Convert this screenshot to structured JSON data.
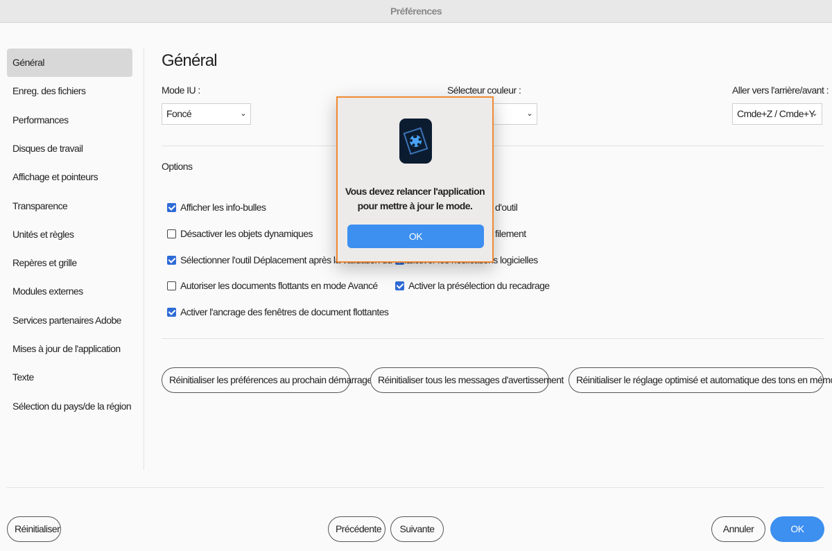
{
  "window": {
    "title": "Préférences"
  },
  "sidebar": {
    "items": [
      {
        "label": "Général",
        "selected": true
      },
      {
        "label": "Enreg. des fichiers"
      },
      {
        "label": "Performances"
      },
      {
        "label": "Disques de travail"
      },
      {
        "label": "Affichage et pointeurs"
      },
      {
        "label": "Transparence"
      },
      {
        "label": "Unités et règles"
      },
      {
        "label": "Repères et grille"
      },
      {
        "label": "Modules externes"
      },
      {
        "label": "Services partenaires Adobe"
      },
      {
        "label": "Mises à jour de l'application"
      },
      {
        "label": "Texte"
      },
      {
        "label": "Sélection du pays/de la région"
      }
    ]
  },
  "main": {
    "title": "Général",
    "ui_mode": {
      "label": "Mode IU :",
      "value": "Foncé"
    },
    "color_picker": {
      "label": "Sélecteur couleur :"
    },
    "undo_redo": {
      "label": "Aller vers l'arrière/avant :",
      "value": "Cmde+Z / Cmde+Y"
    },
    "options_label": "Options",
    "options": [
      {
        "label": "Afficher les info-bulles",
        "checked": true
      },
      {
        "label": "Désactiver les objets dynamiques",
        "checked": false
      },
      {
        "label": "Sélectionner l'outil Déplacement après la validation du texte",
        "checked": true
      },
      {
        "label": "Autoriser les documents flottants en mode Avancé",
        "checked": false
      },
      {
        "label": "Activer l'ancrage des fenêtres de document flottantes",
        "checked": true
      },
      {
        "label": "d'outil"
      },
      {
        "label": "filement"
      },
      {
        "label": "Activer les notifications logicielles",
        "checked": true
      },
      {
        "label": "Activer la présélection du recadrage",
        "checked": true
      }
    ],
    "reset_buttons": [
      "Réinitialiser les préférences au prochain démarrage",
      "Réinitialiser tous les messages d'avertissement",
      "Réinitialiser le réglage optimisé et automatique des tons en mémoire"
    ]
  },
  "footer": {
    "reset": "Réinitialiser",
    "prev": "Précédente",
    "next": "Suivante",
    "cancel": "Annuler",
    "ok": "OK"
  },
  "dialog": {
    "message_line1": "Vous devez relancer l'application",
    "message_line2": "pour mettre à jour le mode.",
    "ok": "OK",
    "icon": "photoshop-elements-app-icon"
  },
  "colors": {
    "accent": "#3d8ff0",
    "dialog_border": "#f08a33",
    "checkbox": "#2e6bd6"
  }
}
